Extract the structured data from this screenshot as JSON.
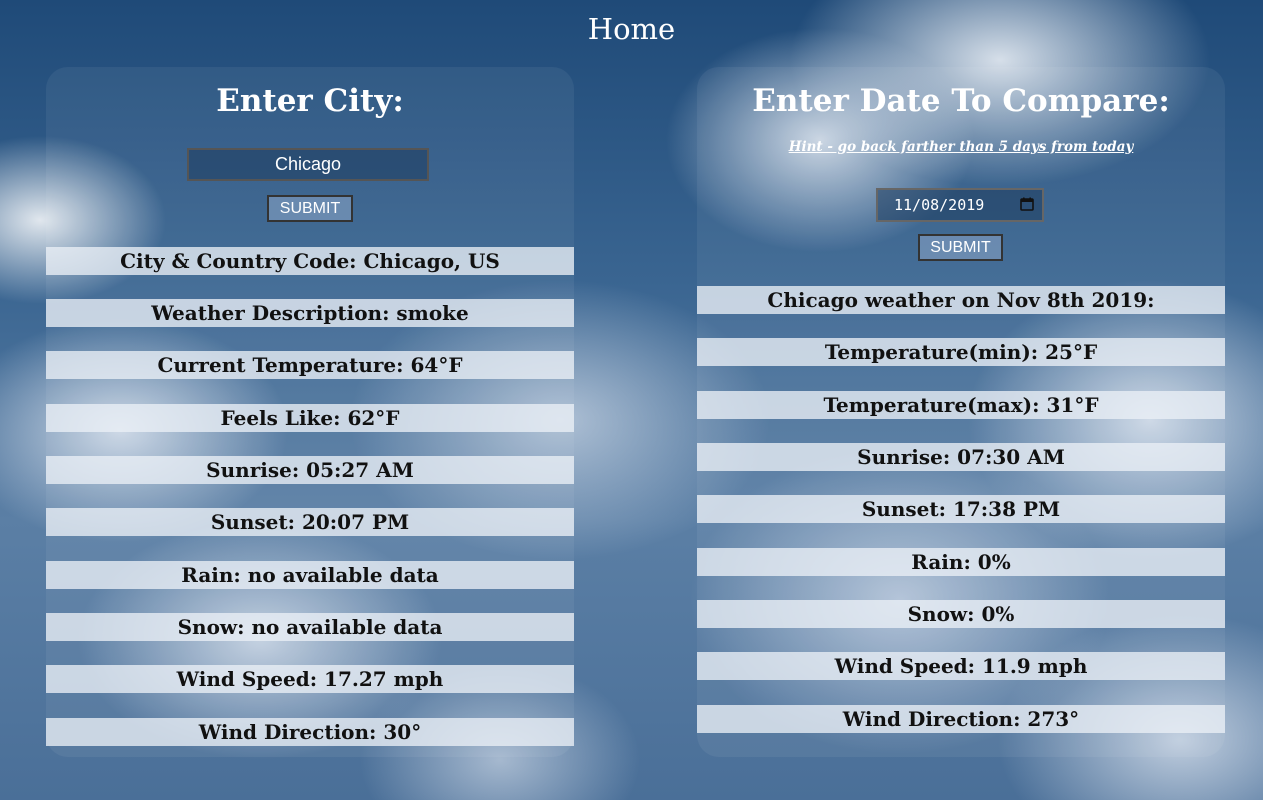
{
  "page": {
    "title": "Home"
  },
  "current": {
    "heading": "Enter City:",
    "city_value": "Chicago",
    "submit_label": "SUBMIT",
    "rows": [
      "City & Country Code: Chicago, US",
      "Weather Description: smoke",
      "Current Temperature: 64°F",
      "Feels Like: 62°F",
      "Sunrise: 05:27 AM",
      "Sunset: 20:07 PM",
      "Rain: no available data",
      "Snow: no available data",
      "Wind Speed: 17.27 mph",
      "Wind Direction: 30°"
    ]
  },
  "compare": {
    "heading": "Enter Date To Compare:",
    "hint": "Hint - go back farther than 5 days from today",
    "date_value": "11/08/2019",
    "submit_label": "SUBMIT",
    "rows": [
      "Chicago weather on Nov 8th 2019:",
      "Temperature(min): 25°F",
      "Temperature(max): 31°F",
      "Sunrise: 07:30 AM",
      "Sunset: 17:38 PM",
      "Rain: 0%",
      "Snow: 0%",
      "Wind Speed: 11.9 mph",
      "Wind Direction: 273°"
    ]
  }
}
